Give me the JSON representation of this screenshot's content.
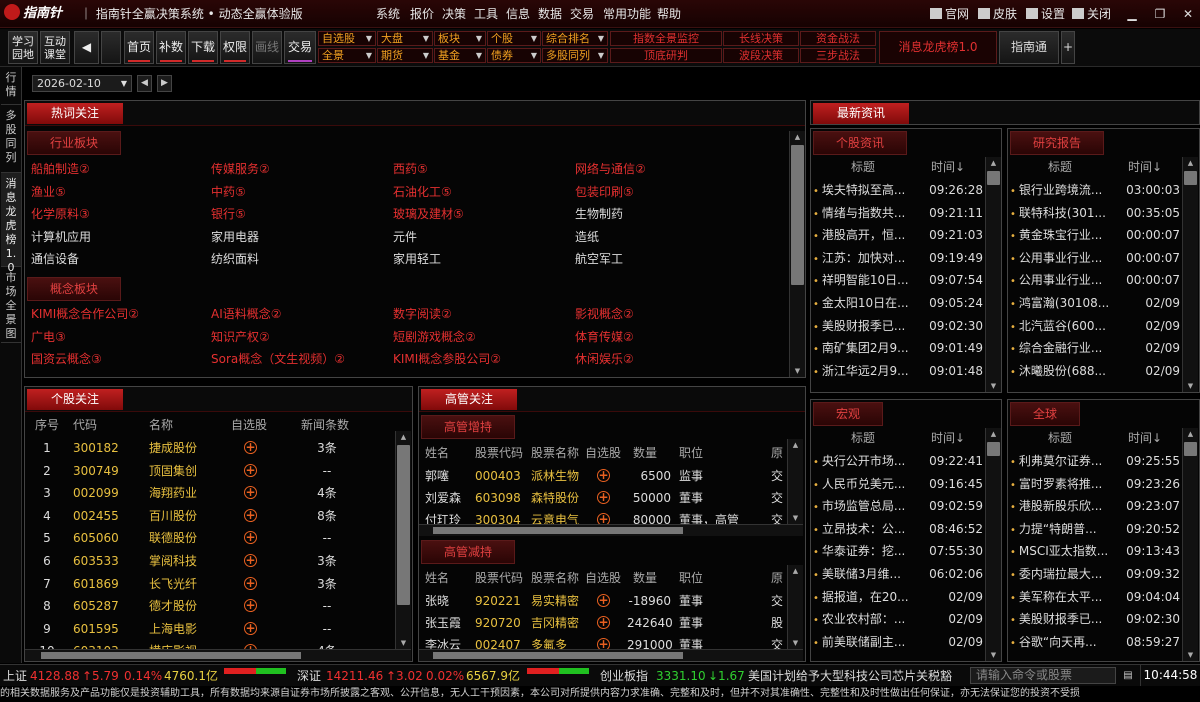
{
  "titlebar": {
    "logo": "指南针",
    "app_name": "指南针全赢决策系统",
    "edition": "动态全赢体验版",
    "menus": [
      "系统",
      "报价",
      "决策",
      "工具",
      "信息",
      "数据",
      "交易",
      "常用功能",
      "帮助"
    ],
    "links": [
      "官网",
      "皮肤",
      "设置",
      "关闭"
    ]
  },
  "toolbar": {
    "study": [
      "学习",
      "园地"
    ],
    "interact": [
      "互动",
      "课堂"
    ],
    "buttons": [
      "首页",
      "补数",
      "下载",
      "权限",
      "画线",
      "交易"
    ],
    "grid_row1": [
      "自选股",
      "大盘",
      "板块",
      "个股",
      "综合排名"
    ],
    "grid_row2": [
      "全景",
      "期货",
      "基金",
      "债券",
      "多股同列"
    ],
    "red_row1": [
      "指数全景监控",
      "长线决策",
      "资金战法"
    ],
    "red_row2": [
      "顶底研判",
      "波段决策",
      "三步战法"
    ],
    "dragon": "消息龙虎榜1.0",
    "znt": "指南通",
    "plus": "+"
  },
  "leftnav": [
    "行情",
    "多股同列",
    "消息龙虎榜1.0",
    "市场全景图"
  ],
  "date": "2026-02-10",
  "hotwords": {
    "title": "热词关注",
    "industry_tag": "行业板块",
    "industry": [
      {
        "t": "船舶制造②",
        "c": "red"
      },
      {
        "t": "传媒服务②",
        "c": "red"
      },
      {
        "t": "西药⑤",
        "c": "red"
      },
      {
        "t": "网络与通信②",
        "c": "red"
      },
      {
        "t": "渔业⑤",
        "c": "red"
      },
      {
        "t": "中药⑤",
        "c": "red"
      },
      {
        "t": "石油化工⑤",
        "c": "red"
      },
      {
        "t": "包装印刷⑤",
        "c": "red"
      },
      {
        "t": "化学原料③",
        "c": "red"
      },
      {
        "t": "银行⑤",
        "c": "red"
      },
      {
        "t": "玻璃及建材⑤",
        "c": "red"
      },
      {
        "t": "生物制药",
        "c": "wht"
      },
      {
        "t": "计算机应用",
        "c": "wht"
      },
      {
        "t": "家用电器",
        "c": "wht"
      },
      {
        "t": "元件",
        "c": "wht"
      },
      {
        "t": "造纸",
        "c": "wht"
      },
      {
        "t": "通信设备",
        "c": "wht"
      },
      {
        "t": "纺织面料",
        "c": "wht"
      },
      {
        "t": "家用轻工",
        "c": "wht"
      },
      {
        "t": "航空军工",
        "c": "wht"
      }
    ],
    "concept_tag": "概念板块",
    "concept": [
      {
        "t": "KIMI概念合作公司②",
        "c": "red"
      },
      {
        "t": "AI语料概念②",
        "c": "red"
      },
      {
        "t": "数字阅读②",
        "c": "red"
      },
      {
        "t": "影视概念②",
        "c": "red"
      },
      {
        "t": "广电③",
        "c": "red"
      },
      {
        "t": "知识产权②",
        "c": "red"
      },
      {
        "t": "短剧游戏概念②",
        "c": "red"
      },
      {
        "t": "体育传媒②",
        "c": "red"
      },
      {
        "t": "国资云概念③",
        "c": "red"
      },
      {
        "t": "Sora概念（文生视频）②",
        "c": "red"
      },
      {
        "t": "KIMI概念参股公司②",
        "c": "red"
      },
      {
        "t": "休闲娱乐②",
        "c": "red"
      }
    ]
  },
  "stocks": {
    "title": "个股关注",
    "headers": [
      "序号",
      "代码",
      "名称",
      "自选股",
      "新闻条数"
    ],
    "rows": [
      [
        "1",
        "300182",
        "捷成股份",
        "3条"
      ],
      [
        "2",
        "300749",
        "顶固集创",
        "--"
      ],
      [
        "3",
        "002099",
        "海翔药业",
        "4条"
      ],
      [
        "4",
        "002455",
        "百川股份",
        "8条"
      ],
      [
        "5",
        "605060",
        "联德股份",
        "--"
      ],
      [
        "6",
        "603533",
        "掌阅科技",
        "3条"
      ],
      [
        "7",
        "601869",
        "长飞光纤",
        "3条"
      ],
      [
        "8",
        "605287",
        "德才股份",
        "--"
      ],
      [
        "9",
        "601595",
        "上海电影",
        "--"
      ],
      [
        "10",
        "603103",
        "横店影视",
        "4条"
      ]
    ]
  },
  "exec": {
    "title": "高管关注",
    "inc_tag": "高管增持",
    "dec_tag": "高管减持",
    "headers": [
      "姓名",
      "股票代码",
      "股票名称",
      "自选股",
      "数量",
      "职位",
      "原"
    ],
    "inc_rows": [
      [
        "郭噻",
        "000403",
        "派林生物",
        "6500",
        "监事",
        "交"
      ],
      [
        "刘爱森",
        "603098",
        "森特股份",
        "50000",
        "董事",
        "交"
      ],
      [
        "付玒玲",
        "300304",
        "云意电气",
        "80000",
        "董事，高管",
        "交"
      ]
    ],
    "dec_rows": [
      [
        "张晓",
        "920221",
        "易实精密",
        "-18960",
        "董事",
        "交"
      ],
      [
        "张玉霞",
        "920720",
        "吉冈精密",
        "242640",
        "董事",
        "股"
      ],
      [
        "李冰云",
        "002407",
        "多氟多",
        "291000",
        "董事",
        "交"
      ]
    ]
  },
  "news": {
    "title": "最新资讯",
    "header_title": "标题",
    "header_time": "时间↓",
    "stock_tag": "个股资讯",
    "stock": [
      [
        "埃夫特拟至高...",
        "09:26:28"
      ],
      [
        "情绪与指数共...",
        "09:21:11"
      ],
      [
        "港股高开，恒...",
        "09:21:03"
      ],
      [
        "江苏：加快对...",
        "09:19:49"
      ],
      [
        "祥明智能10日...",
        "09:07:54"
      ],
      [
        "金太阳10日在...",
        "09:05:24"
      ],
      [
        "美股财报季已...",
        "09:02:30"
      ],
      [
        "南矿集团2月9...",
        "09:01:49"
      ],
      [
        "浙江华远2月9...",
        "09:01:48"
      ]
    ],
    "research_tag": "研究报告",
    "research": [
      [
        "银行业跨境流...",
        "03:00:03"
      ],
      [
        "联特科技(301...",
        "00:35:05"
      ],
      [
        "黄金珠宝行业...",
        "00:00:07"
      ],
      [
        "公用事业行业...",
        "00:00:07"
      ],
      [
        "公用事业行业...",
        "00:00:07"
      ],
      [
        "鸿富瀚(30108...",
        "02/09"
      ],
      [
        "北汽蓝谷(600...",
        "02/09"
      ],
      [
        "综合金融行业...",
        "02/09"
      ],
      [
        "沐曦股份(688...",
        "02/09"
      ]
    ],
    "macro_tag": "宏观",
    "macro": [
      [
        "央行公开市场...",
        "09:22:41"
      ],
      [
        "人民币兑美元...",
        "09:16:45"
      ],
      [
        "市场监管总局...",
        "09:02:59"
      ],
      [
        "立昂技术：公...",
        "08:46:52"
      ],
      [
        "华泰证券：挖...",
        "07:55:30"
      ],
      [
        "美联储3月维...",
        "06:02:06"
      ],
      [
        "据报道，在20...",
        "02/09"
      ],
      [
        "农业农村部：...",
        "02/09"
      ],
      [
        "前美联储副主...",
        "02/09"
      ]
    ],
    "global_tag": "全球",
    "global": [
      [
        "利弗莫尔证券...",
        "09:25:55"
      ],
      [
        "富时罗素将推...",
        "09:23:26"
      ],
      [
        "港股新股乐欣...",
        "09:23:07"
      ],
      [
        "力提“特朗普...",
        "09:20:52"
      ],
      [
        "MSCI亚太指数...",
        "09:13:43"
      ],
      [
        "委内瑞拉最大...",
        "09:09:32"
      ],
      [
        "美军称在太平...",
        "09:04:04"
      ],
      [
        "美股财报季已...",
        "09:02:30"
      ],
      [
        "谷歌“向天再...",
        "08:59:27"
      ]
    ]
  },
  "status": {
    "sh_label": "上证",
    "sh_val": "4128.88",
    "sh_chg": "↑5.79",
    "sh_pct": "0.14%",
    "sh_amt": "4760.1亿",
    "sz_label": "深证",
    "sz_val": "14211.46",
    "sz_chg": "↑3.02",
    "sz_pct": "0.02%",
    "sz_amt": "6567.9亿",
    "cy_label": "创业板指",
    "cy_val": "3331.10",
    "cy_chg": "↓1.67",
    "ticker": "美国计划给予大型科技公司芯片关税豁",
    "cmd_placeholder": "请输入命令或股票",
    "clock": "10:44:58",
    "colors": {
      "up": "#f03030",
      "down": "#30d030"
    }
  },
  "disclaimer": "的相关数据服务及产品功能仅是投资辅助工具，所有数据均来源自证券市场所披露之客观、公开信息，无人工干预因素，本公司对所提供内容力求准确、完整和及时，但并不对其准确性、完整性和及时性做出任何保证，亦无法保证您的投资不受损"
}
